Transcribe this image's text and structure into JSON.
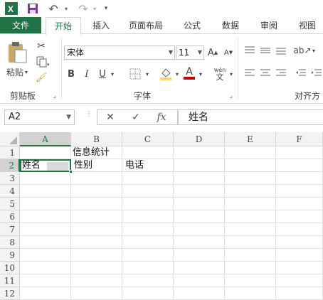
{
  "quick_access": {
    "icons": [
      "excel-icon",
      "save-icon",
      "undo-icon",
      "redo-icon",
      "customize-icon"
    ]
  },
  "tabs": [
    "文件",
    "开始",
    "插入",
    "页面布局",
    "公式",
    "数据",
    "审阅",
    "视图"
  ],
  "ribbon": {
    "paste_label": "粘贴",
    "clipboard_label": "剪贴板",
    "font_name": "宋体",
    "font_size": "11",
    "grow_label": "A",
    "shrink_label": "A",
    "bold": "B",
    "italic": "I",
    "underline": "U",
    "font_color_label": "A",
    "pinyin_top": "wén",
    "pinyin_bottom": "文",
    "font_group_label": "字体",
    "align_group_label": "对齐方",
    "accent_red": "#c00000",
    "accent_yellow": "#ffd966"
  },
  "formula_bar": {
    "name_box": "A2",
    "cancel": "✕",
    "enter": "✓",
    "fx": "fx",
    "content": "姓名"
  },
  "grid": {
    "columns": [
      "A",
      "B",
      "C",
      "D",
      "E",
      "F"
    ],
    "rows": [
      "1",
      "2",
      "3",
      "4",
      "5",
      "6",
      "7",
      "8",
      "9",
      "10",
      "11",
      "12"
    ],
    "selected_cell": "A2",
    "cells": {
      "B1": "信息统计",
      "A2": "姓名",
      "B2": "性别",
      "C2": "电话"
    }
  },
  "colors": {
    "brand": "#217346"
  }
}
